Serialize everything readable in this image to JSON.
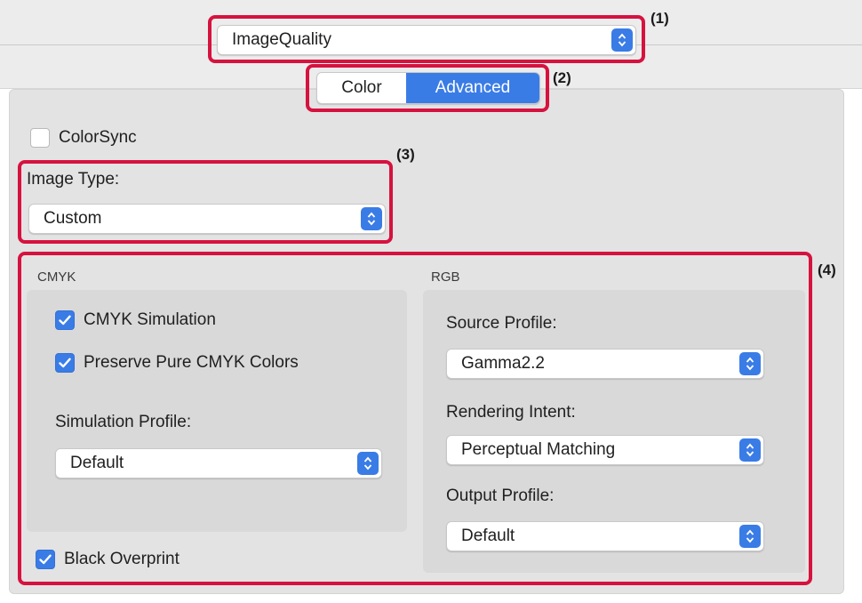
{
  "preset_popup": {
    "value": "ImageQuality"
  },
  "tabs": {
    "color_label": "Color",
    "advanced_label": "Advanced"
  },
  "colorsync": {
    "label": "ColorSync",
    "checked": false
  },
  "image_type": {
    "label": "Image Type:",
    "value": "Custom"
  },
  "cmyk": {
    "header": "CMYK",
    "simulation": {
      "label": "CMYK Simulation",
      "checked": true
    },
    "preserve": {
      "label": "Preserve Pure CMYK Colors",
      "checked": true
    },
    "profile_label": "Simulation Profile:",
    "profile_value": "Default"
  },
  "rgb": {
    "header": "RGB",
    "source_label": "Source Profile:",
    "source_value": "Gamma2.2",
    "intent_label": "Rendering Intent:",
    "intent_value": "Perceptual Matching",
    "output_label": "Output Profile:",
    "output_value": "Default"
  },
  "black_overprint": {
    "label": "Black Overprint",
    "checked": true
  },
  "annotations": [
    "(1)",
    "(2)",
    "(3)",
    "(4)"
  ],
  "colors": {
    "accent": "#3a7ce6",
    "annotation": "#d6123f"
  }
}
